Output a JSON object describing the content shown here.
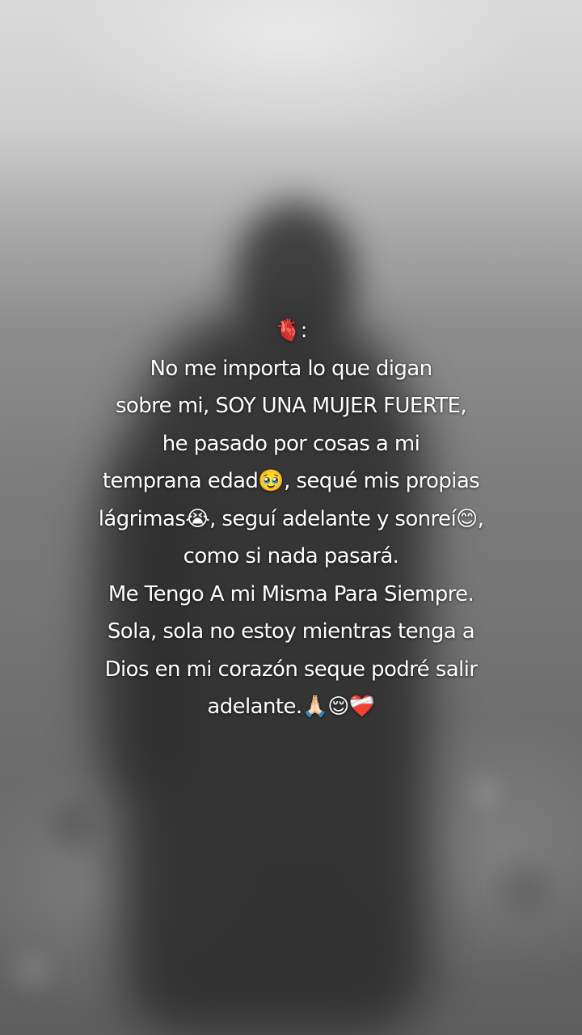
{
  "caption": {
    "lines": [
      "🫀:",
      "No me importa lo que digan",
      "sobre mi, SOY UNA MUJER FUERTE,",
      "he pasado por cosas a mi",
      "temprana edad🥹, sequé mis propias",
      "lágrimas😭, seguí adelante y sonreí😊,",
      "como si nada pasará.",
      "Me Tengo A mi Misma Para Siempre.",
      "Sola, sola no estoy mientras tenga a",
      "Dios en mi corazón seque podré salir",
      "adelante.🙏🏻😌❤️‍🩹"
    ]
  }
}
